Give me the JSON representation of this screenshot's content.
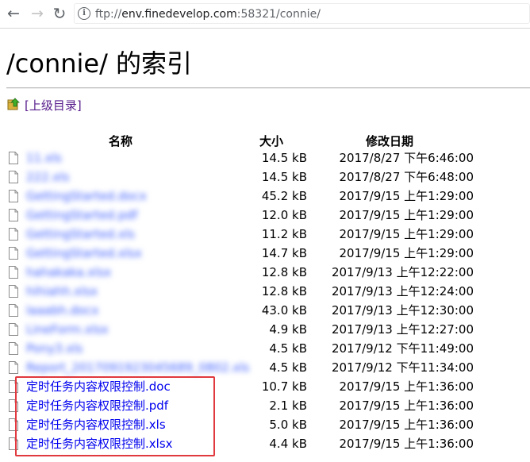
{
  "browser": {
    "back_glyph": "←",
    "forward_glyph": "→",
    "reload_glyph": "↻",
    "url_scheme": "ftp://",
    "url_host": "env.finedevelop.com",
    "url_rest": ":58321/connie/"
  },
  "page": {
    "title": "/connie/ 的索引",
    "parent_link": "[上级目录]"
  },
  "table": {
    "headers": {
      "name": "名称",
      "size": "大小",
      "modified": "修改日期"
    },
    "rows": [
      {
        "name": "11.xls",
        "size": "14.5 kB",
        "date": "2017/8/27 下午6:46:00",
        "blurred": true
      },
      {
        "name": "222.xls",
        "size": "14.5 kB",
        "date": "2017/8/27 下午6:48:00",
        "blurred": true
      },
      {
        "name": "GettingStarted.docx",
        "size": "45.2 kB",
        "date": "2017/9/15 上午1:29:00",
        "blurred": true
      },
      {
        "name": "GettingStarted.pdf",
        "size": "12.0 kB",
        "date": "2017/9/15 上午1:29:00",
        "blurred": true
      },
      {
        "name": "GettingStarted.xls",
        "size": "11.2 kB",
        "date": "2017/9/15 上午1:29:00",
        "blurred": true
      },
      {
        "name": "GettingStarted.xlsx",
        "size": "14.7 kB",
        "date": "2017/9/15 上午1:29:00",
        "blurred": true
      },
      {
        "name": "hahakaka.xlsx",
        "size": "12.8 kB",
        "date": "2017/9/13 上午12:22:00",
        "blurred": true
      },
      {
        "name": "hihiahh.xlsx",
        "size": "12.8 kB",
        "date": "2017/9/13 上午12:24:00",
        "blurred": true
      },
      {
        "name": "laaabh.docx",
        "size": "43.0 kB",
        "date": "2017/9/13 上午12:30:00",
        "blurred": true
      },
      {
        "name": "LineForm.xlsx",
        "size": "4.9 kB",
        "date": "2017/9/13 上午12:27:00",
        "blurred": true
      },
      {
        "name": "Pony3.xls",
        "size": "4.5 kB",
        "date": "2017/9/12 下午11:49:00",
        "blurred": true
      },
      {
        "name": "Report_2017091923045689_0802.xls",
        "size": "4.5 kB",
        "date": "2017/9/12 下午11:34:00",
        "blurred": true
      },
      {
        "name": "定时任务内容权限控制.doc",
        "size": "10.7 kB",
        "date": "2017/9/15 上午1:36:00",
        "blurred": false
      },
      {
        "name": "定时任务内容权限控制.pdf",
        "size": "2.1 kB",
        "date": "2017/9/15 上午1:36:00",
        "blurred": false
      },
      {
        "name": "定时任务内容权限控制.xls",
        "size": "5.0 kB",
        "date": "2017/9/15 上午1:36:00",
        "blurred": false
      },
      {
        "name": "定时任务内容权限控制.xlsx",
        "size": "4.4 kB",
        "date": "2017/9/15 上午1:36:00",
        "blurred": false
      }
    ]
  },
  "colors": {
    "link": "#0000ee",
    "visited_link": "#551a8b",
    "highlight_border": "#e0393e"
  },
  "icons": {
    "info": "info-circle-icon",
    "parent": "folder-up-arrow-icon",
    "file": "generic-file-icon"
  }
}
